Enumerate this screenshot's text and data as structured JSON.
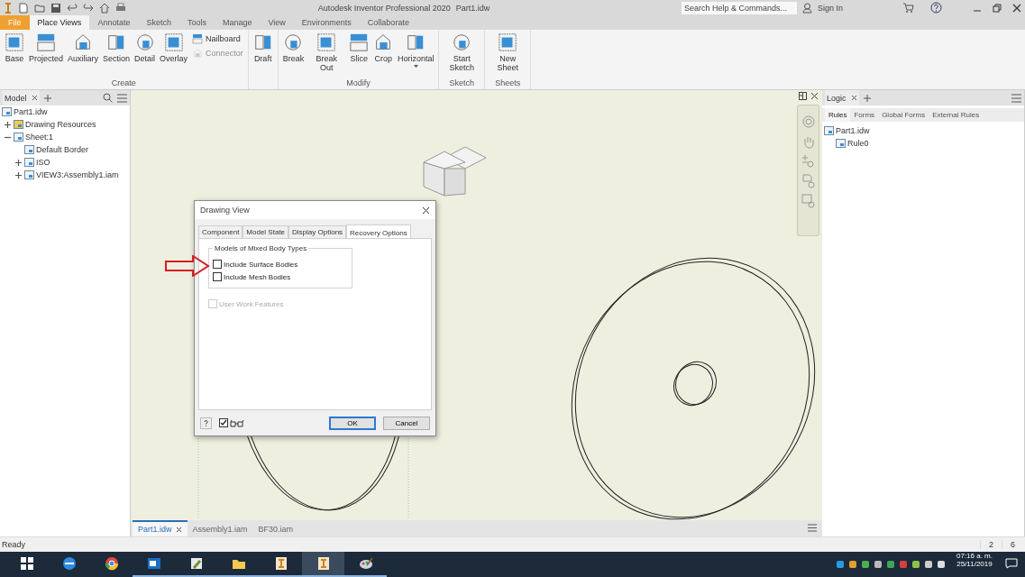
{
  "title_bar": {
    "app_title": "Autodesk Inventor Professional 2020",
    "document": "Part1.idw",
    "search": {
      "placeholder": "Search Help & Commands..."
    },
    "sign_in": "Sign In"
  },
  "ribbon_tabs": [
    {
      "label": "File",
      "kind": "file",
      "selected": false
    },
    {
      "label": "Place Views",
      "kind": "tab",
      "selected": true
    },
    {
      "label": "Annotate",
      "kind": "tab",
      "selected": false
    },
    {
      "label": "Sketch",
      "kind": "tab",
      "selected": false
    },
    {
      "label": "Tools",
      "kind": "tab",
      "selected": false
    },
    {
      "label": "Manage",
      "kind": "tab",
      "selected": false
    },
    {
      "label": "View",
      "kind": "tab",
      "selected": false
    },
    {
      "label": "Environments",
      "kind": "tab",
      "selected": false
    },
    {
      "label": "Collaborate",
      "kind": "tab",
      "selected": false
    }
  ],
  "ribbon_groups": [
    {
      "label": "Create",
      "tools": [
        {
          "label": "Base",
          "kind": "large",
          "disabled": false
        },
        {
          "label": "Projected",
          "kind": "large",
          "disabled": false
        },
        {
          "label": "Auxiliary",
          "kind": "large",
          "disabled": false
        },
        {
          "label": "Section",
          "kind": "large",
          "disabled": false
        },
        {
          "label": "Detail",
          "kind": "large",
          "disabled": false
        },
        {
          "label": "Overlay",
          "kind": "large",
          "disabled": false
        },
        {
          "label": "Nailboard",
          "kind": "small",
          "disabled": false
        },
        {
          "label": "Connector",
          "kind": "small",
          "disabled": true
        }
      ]
    },
    {
      "tools": [
        {
          "label": "Draft",
          "kind": "large",
          "disabled": false
        }
      ]
    },
    {
      "label": "Modify",
      "tools": [
        {
          "label": "Break",
          "kind": "large",
          "disabled": false
        },
        {
          "label": "Break Out",
          "kind": "large",
          "disabled": false
        },
        {
          "label": "Slice",
          "kind": "large",
          "disabled": false
        },
        {
          "label": "Crop",
          "kind": "large",
          "disabled": false
        },
        {
          "label": "Horizontal",
          "kind": "dropdown",
          "disabled": false
        }
      ]
    },
    {
      "label": "Sketch",
      "tools": [
        {
          "label": "Start Sketch",
          "kind": "large",
          "disabled": false
        }
      ]
    },
    {
      "label": "Sheets",
      "tools": [
        {
          "label": "New Sheet",
          "kind": "large",
          "disabled": false
        }
      ]
    }
  ],
  "model_browser": {
    "tab": "Model",
    "tree": [
      {
        "label": "Part1.idw",
        "children": [
          {
            "label": "Drawing Resources",
            "expanded": false
          },
          {
            "label": "Sheet:1",
            "expanded": true,
            "children": [
              {
                "label": "Default Border"
              },
              {
                "label": "ISO",
                "expanded": false
              },
              {
                "label": "VIEW3:Assembly1.iam",
                "expanded": false
              }
            ]
          }
        ]
      }
    ]
  },
  "dialog": {
    "title": "Drawing View",
    "tabs": [
      {
        "label": "Component",
        "selected": false
      },
      {
        "label": "Model State",
        "selected": false
      },
      {
        "label": "Display Options",
        "selected": false
      },
      {
        "label": "Recovery Options",
        "selected": true
      }
    ],
    "group": {
      "title": "Models of Mixed Body Types",
      "options": [
        {
          "label": "Include Surface Bodies",
          "checked": false
        },
        {
          "label": "Include Mesh Bodies",
          "checked": false
        }
      ]
    },
    "extra_options": [
      {
        "label": "User Work Features",
        "checked": false,
        "disabled": true
      }
    ],
    "preview_checked": true,
    "buttons": [
      {
        "label": "OK",
        "default": true
      },
      {
        "label": "Cancel",
        "default": false
      }
    ]
  },
  "document_tabs": [
    {
      "label": "Part1.idw",
      "selected": true
    },
    {
      "label": "Assembly1.iam",
      "selected": false
    },
    {
      "label": "BF30.iam",
      "selected": false
    }
  ],
  "logic_panel": {
    "tab": "Logic",
    "subtabs": [
      {
        "label": "Rules",
        "selected": true
      },
      {
        "label": "Forms",
        "selected": false
      },
      {
        "label": "Global Forms",
        "selected": false
      },
      {
        "label": "External Rules",
        "selected": false
      }
    ],
    "tree": [
      {
        "label": "Part1.idw",
        "children": [
          {
            "label": "Rule0"
          }
        ]
      }
    ]
  },
  "status_bar": {
    "message": "Ready",
    "fields": [
      "2",
      "6"
    ]
  },
  "taskbar": {
    "apps": [
      {
        "kind": "globe",
        "running": false,
        "selected": false
      },
      {
        "kind": "ring",
        "running": false,
        "selected": false
      },
      {
        "kind": "mail",
        "running": true,
        "selected": false
      },
      {
        "kind": "pencil",
        "running": true,
        "selected": false
      },
      {
        "kind": "folder",
        "running": true,
        "selected": false
      },
      {
        "kind": "tool",
        "running": true,
        "selected": false
      },
      {
        "kind": "tool",
        "running": true,
        "selected": true
      },
      {
        "kind": "palette",
        "running": true,
        "selected": false
      }
    ],
    "time": "07:16 a. m.",
    "date": "25/11/2019"
  }
}
